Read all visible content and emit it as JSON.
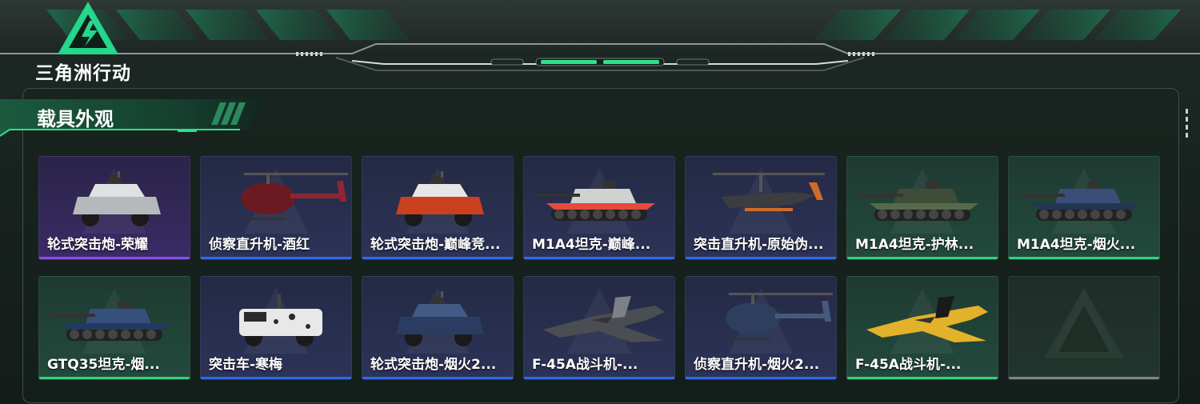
{
  "app": {
    "logo_text": "三角洲行动"
  },
  "section": {
    "title": "载具外观"
  },
  "colors": {
    "accent": "#2fe08a",
    "rarity_purple": "#8a4cf0",
    "rarity_blue": "#2f6bea",
    "rarity_green": "#2fd47e",
    "rarity_empty": "#7c8580"
  },
  "items": [
    {
      "label": "轮式突击炮-荣耀",
      "rarity": "purple",
      "vehicle_icon": "armored-car-icon"
    },
    {
      "label": "侦察直升机-酒红",
      "rarity": "blue",
      "vehicle_icon": "helicopter-icon"
    },
    {
      "label": "轮式突击炮-巅峰竞...",
      "rarity": "blue",
      "vehicle_icon": "armored-car-icon"
    },
    {
      "label": "M1A4坦克-巅峰...",
      "rarity": "blue",
      "vehicle_icon": "tank-icon"
    },
    {
      "label": "突击直升机-原始伪...",
      "rarity": "blue",
      "vehicle_icon": "attack-helicopter-icon"
    },
    {
      "label": "M1A4坦克-护林...",
      "rarity": "green",
      "vehicle_icon": "tank-icon"
    },
    {
      "label": "M1A4坦克-烟火...",
      "rarity": "green",
      "vehicle_icon": "tank-icon"
    },
    {
      "label": "GTQ35坦克-烟...",
      "rarity": "green",
      "vehicle_icon": "tank-icon"
    },
    {
      "label": "突击车-寒梅",
      "rarity": "blue",
      "vehicle_icon": "assault-vehicle-icon"
    },
    {
      "label": "轮式突击炮-烟火2...",
      "rarity": "blue",
      "vehicle_icon": "armored-car-icon"
    },
    {
      "label": "F-45A战斗机-...",
      "rarity": "blue",
      "vehicle_icon": "fighter-jet-icon"
    },
    {
      "label": "侦察直升机-烟火2...",
      "rarity": "blue",
      "vehicle_icon": "helicopter-icon"
    },
    {
      "label": "F-45A战斗机-...",
      "rarity": "green",
      "vehicle_icon": "fighter-jet-icon"
    },
    {
      "label": "",
      "rarity": "empty",
      "vehicle_icon": "placeholder-logo-icon"
    }
  ]
}
